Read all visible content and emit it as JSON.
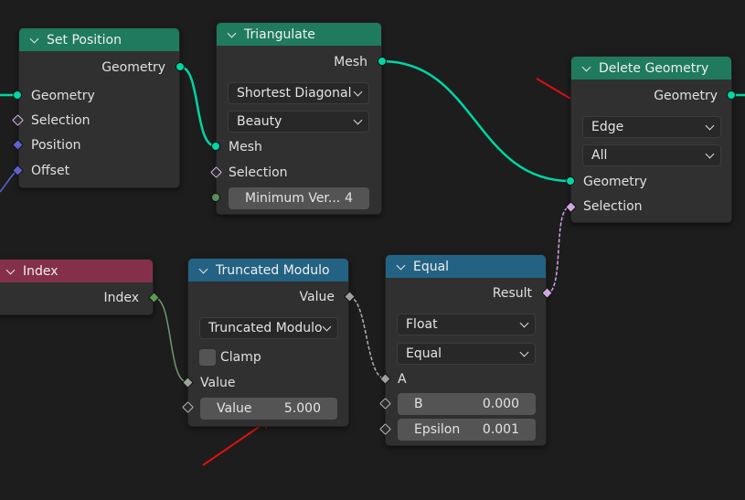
{
  "nodes": {
    "set_position": {
      "title": "Set Position",
      "output": "Geometry",
      "inputs": [
        "Geometry",
        "Selection",
        "Position",
        "Offset"
      ]
    },
    "triangulate": {
      "title": "Triangulate",
      "output": "Mesh",
      "quad_method": "Shortest Diagonal",
      "ngon_method": "Beauty",
      "inputs": [
        "Mesh",
        "Selection"
      ],
      "min_vertices": {
        "label": "Minimum Ver...",
        "value": "4"
      }
    },
    "delete_geometry": {
      "title": "Delete Geometry",
      "output": "Geometry",
      "domain": "Edge",
      "mode": "All",
      "inputs": [
        "Geometry",
        "Selection"
      ]
    },
    "index": {
      "title": "Index",
      "output": "Index"
    },
    "truncated_modulo": {
      "title": "Truncated Modulo",
      "output": "Value",
      "operation": "Truncated Modulo",
      "clamp_label": "Clamp",
      "clamp_checked": false,
      "inputs": [
        "Value"
      ],
      "value_field": {
        "label": "Value",
        "value": "5.000"
      }
    },
    "equal": {
      "title": "Equal",
      "output": "Result",
      "data_type": "Float",
      "operation": "Equal",
      "inputs": [
        "A"
      ],
      "b_field": {
        "label": "B",
        "value": "0.000"
      },
      "epsilon_field": {
        "label": "Epsilon",
        "value": "0.001"
      }
    }
  },
  "colors": {
    "background": "#1d1d1d",
    "node_body": "#303030",
    "geometry_header": "#1f7a5e",
    "input_header": "#84304a",
    "utility_header": "#246283",
    "geometry_socket": "#00d6a3",
    "annotation_arrow": "#e01010"
  },
  "annotations": {
    "arrows": [
      "arrow-to-edge-dropdown",
      "arrow-to-value-field"
    ]
  }
}
